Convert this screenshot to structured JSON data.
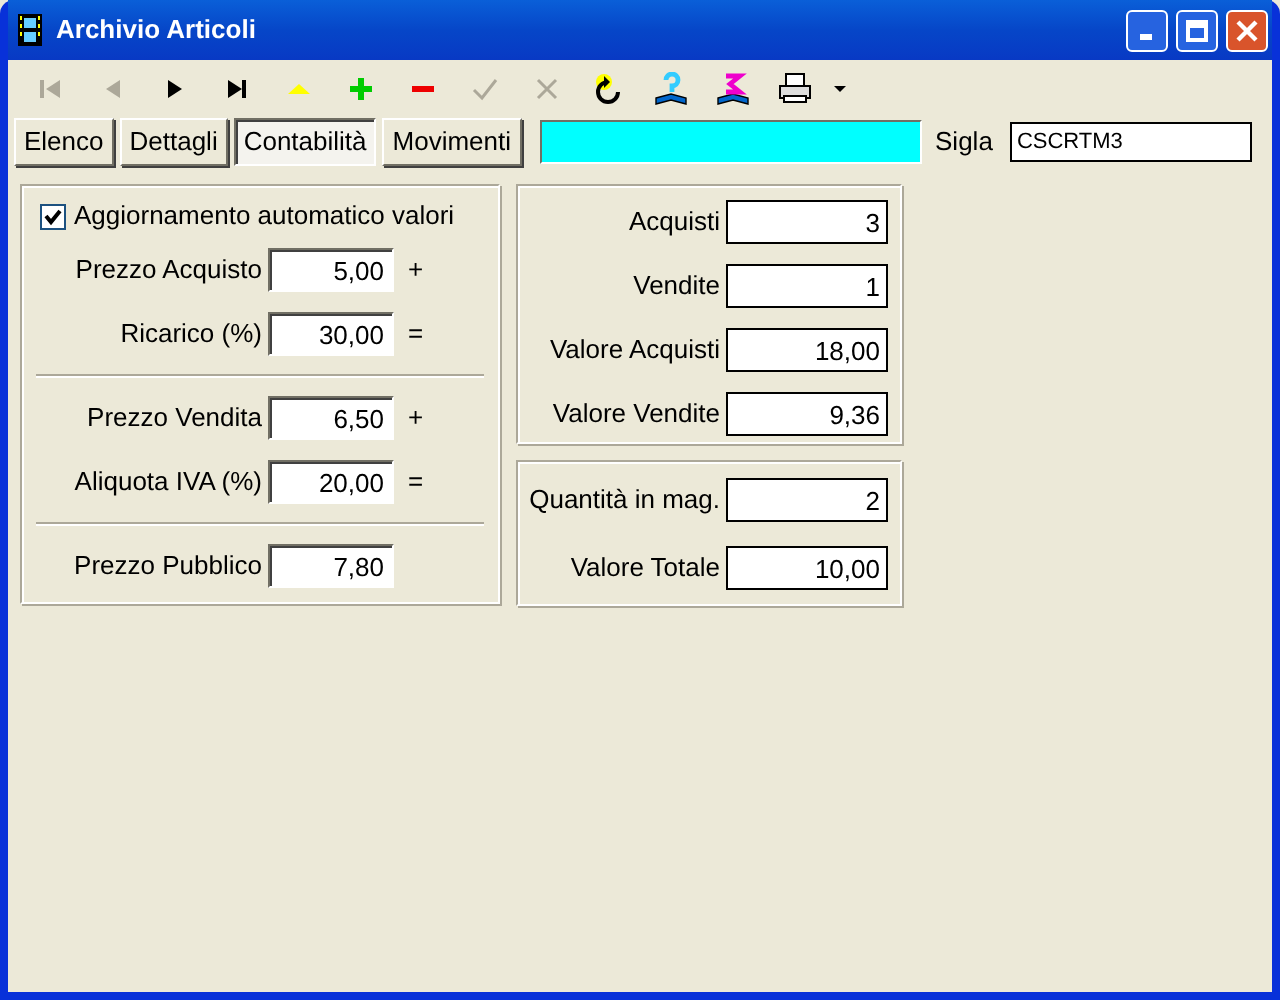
{
  "window": {
    "title": "Archivio Articoli"
  },
  "toolbar": [
    {
      "kind": "first",
      "disabled": true
    },
    {
      "kind": "prev",
      "disabled": true
    },
    {
      "kind": "next",
      "disabled": false
    },
    {
      "kind": "last",
      "disabled": false
    },
    {
      "kind": "up",
      "disabled": false
    },
    {
      "kind": "add",
      "disabled": false
    },
    {
      "kind": "remove",
      "disabled": false
    },
    {
      "kind": "confirm",
      "disabled": true
    },
    {
      "kind": "cancel",
      "disabled": true
    },
    {
      "kind": "refresh",
      "disabled": false
    },
    {
      "kind": "book-query",
      "disabled": false
    },
    {
      "kind": "book-sum",
      "disabled": false
    },
    {
      "kind": "print",
      "disabled": false
    },
    {
      "kind": "dropdown",
      "disabled": false
    }
  ],
  "tabs": [
    {
      "label": "Elenco",
      "selected": false
    },
    {
      "label": "Dettagli",
      "selected": false
    },
    {
      "label": "Contabilità",
      "selected": true
    },
    {
      "label": "Movimenti",
      "selected": false
    }
  ],
  "sigla": {
    "label": "Sigla",
    "value": "CSCRTM3"
  },
  "prices": {
    "auto_update": {
      "label": "Aggiornamento automatico valori",
      "checked": true
    },
    "groups": [
      [
        {
          "label": "Prezzo Acquisto",
          "value": "5,00",
          "operator": "+"
        },
        {
          "label": "Ricarico (%)",
          "value": "30,00",
          "operator": "="
        }
      ],
      [
        {
          "label": "Prezzo Vendita",
          "value": "6,50",
          "operator": "+"
        },
        {
          "label": "Aliquota IVA (%)",
          "value": "20,00",
          "operator": "="
        }
      ],
      [
        {
          "label": "Prezzo Pubblico",
          "value": "7,80"
        }
      ]
    ]
  },
  "movements": [
    {
      "label": "Acquisti",
      "value": "3"
    },
    {
      "label": "Vendite",
      "value": "1"
    },
    {
      "label": "Valore Acquisti",
      "value": "18,00"
    },
    {
      "label": "Valore Vendite",
      "value": "9,36"
    }
  ],
  "stock": [
    {
      "label": "Quantità in mag.",
      "value": "2"
    },
    {
      "label": "Valore Totale",
      "value": "10,00"
    }
  ]
}
